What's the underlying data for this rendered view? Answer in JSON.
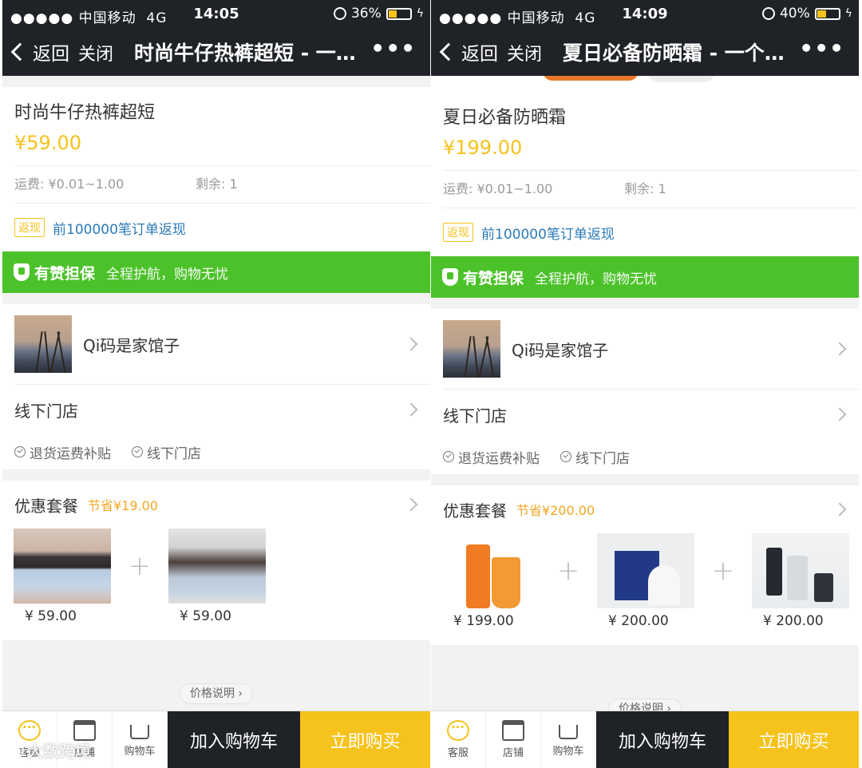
{
  "screens": [
    {
      "status": {
        "signal": "●●●●● 中国移动",
        "network": "4G",
        "time": "14:05",
        "battery": "36%",
        "battery_level": 0.36
      },
      "nav": {
        "back": "返回",
        "close": "关闭",
        "title": "时尚牛仔热裤超短 - 一…"
      },
      "product": {
        "name": "时尚牛仔热裤超短",
        "price": "¥59.00"
      },
      "meta": {
        "shipping": "运费: ¥0.01~1.00",
        "remaining": "剩余: 1"
      },
      "cashback": {
        "badge": "返现",
        "text": "前100000笔订单返现"
      },
      "guarantee": {
        "title": "有赞担保",
        "subtitle": "全程护航，购物无忧"
      },
      "shop": {
        "name": "Qi码是家馆子"
      },
      "offline": {
        "label": "线下门店"
      },
      "tags": [
        "退货运费补贴",
        "线下门店"
      ],
      "combo": {
        "title": "优惠套餐",
        "save": "节省¥19.00",
        "prices": [
          "¥ 59.00",
          "¥ 59.00"
        ]
      },
      "price_note": "价格说明 ›",
      "bottom": {
        "service": "客服",
        "store": "店铺",
        "cart": "购物车",
        "add_cart": "加入购物车",
        "buy_now": "立即购买"
      }
    },
    {
      "status": {
        "signal": "●●●●● 中国移动",
        "network": "4G",
        "time": "14:09",
        "battery": "40%",
        "battery_level": 0.4
      },
      "nav": {
        "back": "返回",
        "close": "关闭",
        "title": "夏日必备防晒霜 - 一个…"
      },
      "product": {
        "name": "夏日必备防晒霜",
        "price": "¥199.00"
      },
      "meta": {
        "shipping": "运费: ¥0.01~1.00",
        "remaining": "剩余: 1"
      },
      "cashback": {
        "badge": "返现",
        "text": "前100000笔订单返现"
      },
      "guarantee": {
        "title": "有赞担保",
        "subtitle": "全程护航，购物无忧"
      },
      "shop": {
        "name": "Qi码是家馆子"
      },
      "offline": {
        "label": "线下门店"
      },
      "tags": [
        "退货运费补贴",
        "线下门店"
      ],
      "combo": {
        "title": "优惠套餐",
        "save": "节省¥200.00",
        "prices": [
          "¥ 199.00",
          "¥ 200.00",
          "¥ 200.00"
        ]
      },
      "price_note": "价格说明 ›",
      "bottom": {
        "service": "客服",
        "store": "店铺",
        "cart": "购物车",
        "add_cart": "加入购物车",
        "buy_now": "立即购买"
      }
    }
  ],
  "watermark": "大数跨境",
  "colors": {
    "accent": "#f6c21c",
    "guarantee_green": "#4cc22a",
    "dark": "#1f2226",
    "link_blue": "#2a7ab8",
    "save_orange": "#f5a623"
  }
}
